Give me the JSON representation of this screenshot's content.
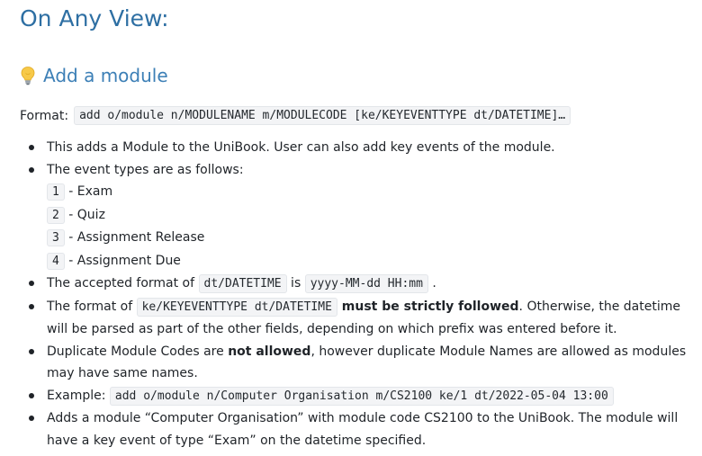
{
  "page": {
    "title": "On Any View:",
    "section": {
      "icon": "lightbulb-icon",
      "title": "Add a module"
    },
    "format": {
      "label": "Format:",
      "code": "add o/module n/MODULENAME m/MODULECODE [ke/KEYEVENTTYPE dt/DATETIME]…"
    },
    "bullets": {
      "b1": "This adds a Module to the UniBook. User can also add key events of the module.",
      "b2": "The event types are as follows:",
      "event_types": [
        {
          "code": "1",
          "label": " - Exam"
        },
        {
          "code": "2",
          "label": " - Quiz"
        },
        {
          "code": "3",
          "label": " - Assignment Release"
        },
        {
          "code": "4",
          "label": " - Assignment Due"
        }
      ],
      "b3": {
        "pre": "The accepted format of ",
        "code1": "dt/DATETIME",
        "mid": " is ",
        "code2": "yyyy-MM-dd HH:mm",
        "post": " ."
      },
      "b4": {
        "pre": "The format of ",
        "code": "ke/KEYEVENTTYPE dt/DATETIME",
        "bold": " must be strictly followed",
        "post": ". Otherwise, the datetime will be parsed as part of the other fields, depending on which prefix was entered before it."
      },
      "b5": {
        "pre": "Duplicate Module Codes are ",
        "bold": "not allowed",
        "post": ", however duplicate Module Names are allowed as modules may have same names."
      },
      "b6": {
        "pre": "Example: ",
        "code": "add o/module n/Computer Organisation m/CS2100 ke/1 dt/2022-05-04 13:00"
      },
      "b7": "Adds a module “Computer Organisation” with module code CS2100 to the UniBook. The module will have a key event of type “Exam” on the datetime specified."
    }
  },
  "colors": {
    "heading": "#2e6fa3",
    "subheading": "#3c7fb6",
    "code_bg": "#f3f4f6"
  }
}
